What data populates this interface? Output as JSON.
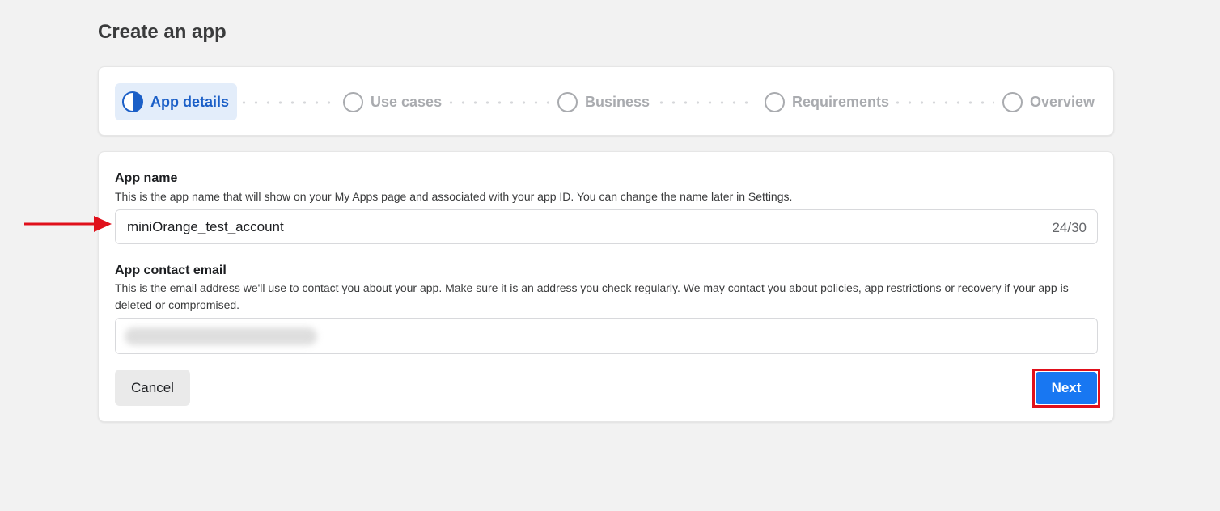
{
  "page": {
    "title": "Create an app"
  },
  "stepper": {
    "steps": [
      {
        "label": "App details",
        "state": "active"
      },
      {
        "label": "Use cases",
        "state": "pending"
      },
      {
        "label": "Business",
        "state": "pending"
      },
      {
        "label": "Requirements",
        "state": "pending"
      },
      {
        "label": "Overview",
        "state": "pending"
      }
    ]
  },
  "form": {
    "app_name": {
      "label": "App name",
      "description": "This is the app name that will show on your My Apps page and associated with your app ID. You can change the name later in Settings.",
      "value": "miniOrange_test_account",
      "char_count": "24/30"
    },
    "contact_email": {
      "label": "App contact email",
      "description": "This is the email address we'll use to contact you about your app. Make sure it is an address you check regularly. We may contact you about policies, app restrictions or recovery if your app is deleted or compromised.",
      "value": ""
    },
    "cancel_label": "Cancel",
    "next_label": "Next"
  },
  "colors": {
    "accent": "#1877f2",
    "active_step": "#1b5fc7",
    "highlight": "#e0101b"
  }
}
